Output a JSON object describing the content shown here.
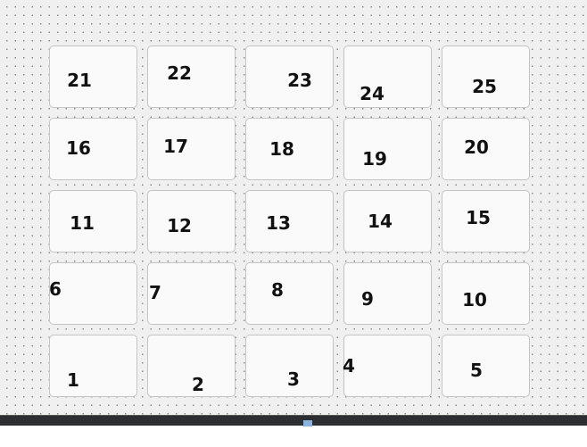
{
  "grid": {
    "rows": [
      [
        "21",
        "22",
        "23",
        "24",
        "25"
      ],
      [
        "16",
        "17",
        "18",
        "19",
        "20"
      ],
      [
        "11",
        "12",
        "13",
        "14",
        "15"
      ],
      [
        "6",
        "7",
        "8",
        "9",
        "10"
      ],
      [
        "1",
        "2",
        "3",
        "4",
        "5"
      ]
    ]
  },
  "colors": {
    "canvas": "#f0f0f0",
    "cell": "#fafafa",
    "taskbar": "#2d2e32",
    "indicator": "#8ab4e0"
  }
}
